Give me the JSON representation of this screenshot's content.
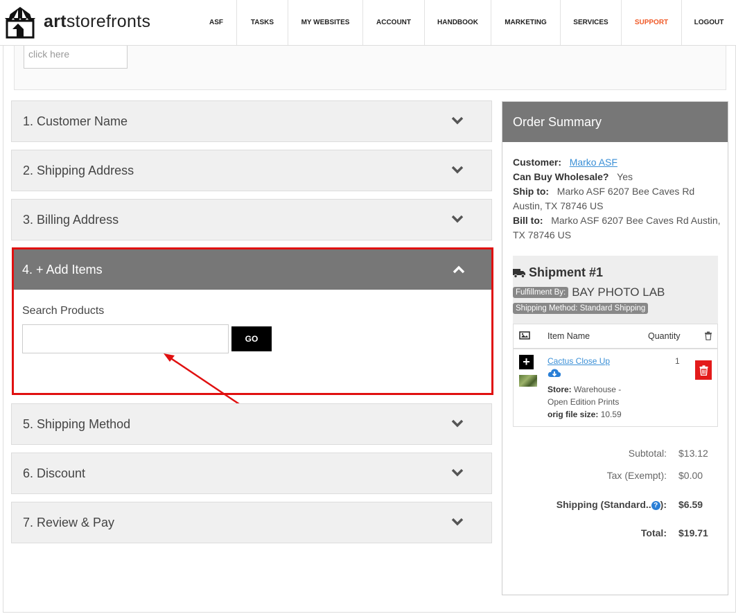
{
  "brand": {
    "bold": "art",
    "rest": "storefronts"
  },
  "nav": [
    "ASF",
    "TASKS",
    "MY WEBSITES",
    "ACCOUNT",
    "HANDBOOK",
    "MARKETING",
    "SERVICES",
    "SUPPORT",
    "LOGOUT"
  ],
  "top_input_placeholder": "click here",
  "sections": {
    "customer_name": "1. Customer Name",
    "shipping_address": "2. Shipping Address",
    "billing_address": "3. Billing Address",
    "add_items": "4. + Add Items",
    "shipping_method": "5. Shipping Method",
    "discount": "6. Discount",
    "review_pay": "7. Review & Pay"
  },
  "add_items": {
    "search_label": "Search Products",
    "search_value": "",
    "go_label": "GO"
  },
  "order_summary": {
    "title": "Order Summary",
    "customer_label": "Customer:",
    "customer_value": "Marko ASF",
    "wholesale_label": "Can Buy Wholesale?",
    "wholesale_value": "Yes",
    "ship_to_label": "Ship to:",
    "ship_to_value": "Marko ASF 6207 Bee Caves Rd Austin, TX 78746 US",
    "bill_to_label": "Bill to:",
    "bill_to_value": "Marko ASF 6207 Bee Caves Rd Austin, TX 78746 US",
    "shipment": {
      "title": "Shipment #1",
      "fulfillment_label": "Fulfillment By:",
      "fulfillment_value": "BAY PHOTO LAB",
      "method_label": "Shipping Method: Standard Shipping",
      "headers": {
        "item_name": "Item Name",
        "quantity": "Quantity"
      },
      "item": {
        "name": "Cactus Close Up",
        "store_label": "Store:",
        "store_value": "Warehouse - Open Edition Prints",
        "size_label": "orig file size:",
        "size_value": "10.59",
        "quantity": "1"
      }
    },
    "totals": {
      "subtotal_label": "Subtotal:",
      "subtotal": "$13.12",
      "tax_label": "Tax (Exempt):",
      "tax": "$0.00",
      "shipping_label": "Shipping (Standard..",
      "shipping_suffix": "):",
      "shipping": "$6.59",
      "total_label": "Total:",
      "total": "$19.71"
    }
  },
  "colors": {
    "highlight": "#e01010",
    "support": "#f05a28",
    "link": "#3a8fd6",
    "delete": "#e31b1b",
    "header_grey": "#777777"
  }
}
